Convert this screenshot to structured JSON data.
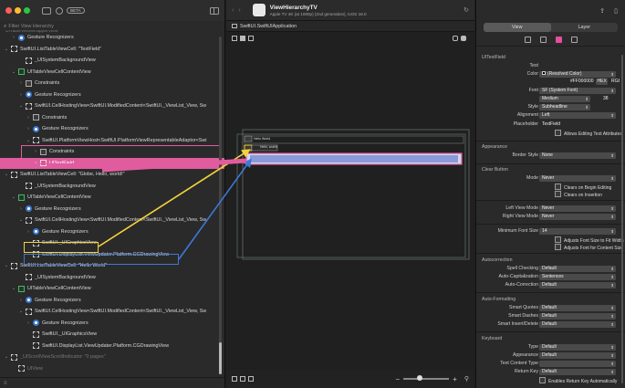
{
  "window": {
    "beta_badge": "BETA"
  },
  "left": {
    "search_placeholder": "Filter View Hierarchy",
    "top_partial": "UITableViewWrapperView",
    "tree": [
      {
        "label": "Gesture Recognizers",
        "icon": "gr",
        "indent": 1,
        "chev": ">"
      },
      {
        "label": "SwiftUI.ListTableViewCell: \"TextField\"",
        "icon": "box",
        "indent": 0,
        "chev": "v"
      },
      {
        "label": "_UISystemBackgroundView",
        "icon": "box",
        "indent": 2,
        "chev": ""
      },
      {
        "label": "UITableViewCellContentView",
        "icon": "tv",
        "indent": 1,
        "chev": "v"
      },
      {
        "label": "Constraints",
        "icon": "cs",
        "indent": 2,
        "chev": ">"
      },
      {
        "label": "Gesture Recognizers",
        "icon": "gr",
        "indent": 2,
        "chev": ">"
      },
      {
        "label": "SwiftUI.CellHostingView<SwiftUI.ModifiedContent<SwiftUI._ViewList_View, Sw",
        "icon": "box",
        "indent": 2,
        "chev": "v"
      },
      {
        "label": "Constraints",
        "icon": "cs",
        "indent": 3,
        "chev": ">"
      },
      {
        "label": "Gesture Recognizers",
        "icon": "gr",
        "indent": 3,
        "chev": ">"
      },
      {
        "label": "SwiftUI.PlatformViewHost<SwiftUI.PlatformViewRepresentableAdaptor<Swi",
        "icon": "box",
        "indent": 3,
        "chev": "v"
      },
      {
        "label": "Constraints",
        "icon": "cs",
        "indent": 4,
        "chev": ">"
      },
      {
        "label": "UITextField",
        "icon": "tf",
        "indent": 4,
        "chev": ">",
        "selected": true
      },
      {
        "label": "SwiftUI.ListTableViewCell: \"Globe, Hello, world!\"",
        "icon": "box",
        "indent": 0,
        "chev": "v"
      },
      {
        "label": "_UISystemBackgroundView",
        "icon": "box",
        "indent": 2,
        "chev": ""
      },
      {
        "label": "UITableViewCellContentView",
        "icon": "tv",
        "indent": 1,
        "chev": "v"
      },
      {
        "label": "Gesture Recognizers",
        "icon": "gr",
        "indent": 2,
        "chev": ">"
      },
      {
        "label": "SwiftUI.CellHostingView<SwiftUI.ModifiedContent<SwiftUI._ViewList_View, Sw",
        "icon": "box",
        "indent": 2,
        "chev": "v"
      },
      {
        "label": "Gesture Recognizers",
        "icon": "gr",
        "indent": 3,
        "chev": ">"
      },
      {
        "label": "SwiftUI._UIGraphicsView",
        "icon": "box",
        "indent": 3,
        "chev": ""
      },
      {
        "label": "SwiftUI.DisplayList.ViewUpdater.Platform.CGDrawingView",
        "icon": "box",
        "indent": 3,
        "chev": ""
      },
      {
        "label": "SwiftUI.ListTableViewCell: \"Hello World\"",
        "icon": "box",
        "indent": 0,
        "chev": "v"
      },
      {
        "label": "_UISystemBackgroundView",
        "icon": "box",
        "indent": 2,
        "chev": ""
      },
      {
        "label": "UITableViewCellContentView",
        "icon": "tv",
        "indent": 1,
        "chev": "v"
      },
      {
        "label": "Gesture Recognizers",
        "icon": "gr",
        "indent": 2,
        "chev": ">"
      },
      {
        "label": "SwiftUI.CellHostingView<SwiftUI.ModifiedContent<SwiftUI._ViewList_View, Sw",
        "icon": "box",
        "indent": 2,
        "chev": "v"
      },
      {
        "label": "Gesture Recognizers",
        "icon": "gr",
        "indent": 3,
        "chev": ">"
      },
      {
        "label": "SwiftUI._UIGraphicsView",
        "icon": "box",
        "indent": 3,
        "chev": ""
      },
      {
        "label": "SwiftUI.DisplayList.ViewUpdater.Platform.CGDrawingView",
        "icon": "box",
        "indent": 3,
        "chev": ""
      },
      {
        "label": "_UIScrollViewScrollIndicator: \"0 pages\"",
        "icon": "box",
        "indent": 0,
        "chev": "v",
        "dim": true
      },
      {
        "label": "UIView",
        "icon": "box",
        "indent": 1,
        "chev": "",
        "dim": true
      }
    ]
  },
  "center": {
    "app_title": "ViewHierarchyTV",
    "app_subtitle": "Apple TV 4K (at 1080p) (2nd generation), tvOS 18.0",
    "breadcrumb": "SwiftUI.SwiftUIApplication",
    "canvas_label_1": "Hello World",
    "canvas_label_2": "Hello, world!",
    "zoom_minus": "−",
    "zoom_plus": "+",
    "zoom_level": 0.35
  },
  "right": {
    "seg_view": "View",
    "seg_layer": "Layer",
    "section_textfield": "UITextField",
    "text_label": "Text",
    "color_label": "Color",
    "color_value": "(Resolved Color)",
    "hex_value": "#FF000000",
    "hex_btn": "HEX",
    "rgb_btn": "RGB",
    "font_label": "Font",
    "font_value": "SF (System Font)",
    "font_weight": "Medium",
    "font_size": "38",
    "style_label": "Style",
    "style_value": "Subheadline",
    "alignment_label": "Alignment",
    "alignment_value": "Left",
    "placeholder_label": "Placeholder",
    "placeholder_value": "TextField",
    "allows_editing": "Allows Editing Text Attributes",
    "appearance_section": "Appearance",
    "border_style_label": "Border Style",
    "border_style_value": "None",
    "clear_button_section": "Clear Button",
    "mode_label": "Mode",
    "mode_value": "Never",
    "clears_begin": "Clears on Begin Editing",
    "clears_insertion": "Clears on Insertion",
    "left_view_label": "Left View Mode",
    "left_view_value": "Never",
    "right_view_label": "Right View Mode",
    "right_view_value": "Never",
    "min_font_label": "Minimum Font Size",
    "min_font_value": "14",
    "adjusts_fit": "Adjusts Font Size to Fit Width",
    "adjusts_content": "Adjusts Font for Content Size",
    "autocorrection_section": "Autocorrection",
    "spell_label": "Spell Checking",
    "spell_value": "Default",
    "autocap_label": "Auto-Capitalization",
    "autocap_value": "Sentences",
    "autocorr_label": "Auto-Correction",
    "autocorr_value": "Default",
    "autoformat_section": "Auto-Formatting",
    "smartq_label": "Smart Quotes",
    "smartq_value": "Default",
    "smartd_label": "Smart Dashes",
    "smartd_value": "Default",
    "smarti_label": "Smart Insert/Delete",
    "smarti_value": "Default",
    "keyboard_section": "Keyboard",
    "type_label": "Type",
    "type_value": "Default",
    "appearance_label": "Appearance",
    "appearance_value": "Default",
    "content_type_label": "Text Content Type",
    "content_type_value": "",
    "return_key_label": "Return Key",
    "return_key_value": "Default",
    "enables_return": "Enables Return Key Automatically"
  },
  "colors": {
    "accent_pink": "#e05c9f",
    "yellow": "#f2d33b",
    "blue": "#3f78d6",
    "traffic_red": "#ff5f57",
    "traffic_yellow": "#febc2e",
    "traffic_green": "#28c840"
  }
}
